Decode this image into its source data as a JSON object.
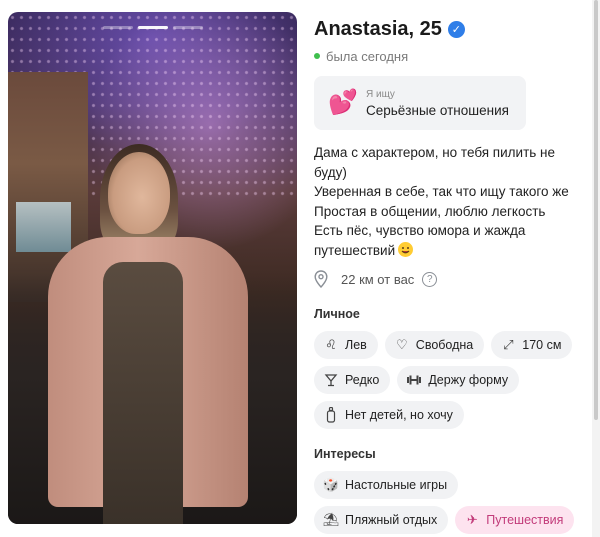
{
  "profile": {
    "name": "Anastasia, 25",
    "status": "была сегодня",
    "colors": {
      "accent": "#2f7ee8",
      "online": "#3fbf4d",
      "highlight_chip_bg": "#fde3ef",
      "highlight_chip_text": "#c23b7a"
    }
  },
  "photo": {
    "alt": "profile-photo",
    "segments": 3,
    "active_segment": 1
  },
  "seeking": {
    "label": "Я ищу",
    "value": "Серьёзные отношения",
    "icon": "hearts-icon"
  },
  "bio": {
    "line1": "Дама с характером, но тебя пилить не",
    "line2": "буду)",
    "line3": "Уверенная в себе, так что ищу такого же",
    "line4": "Простая в общении, люблю легкость",
    "line5": "Есть пёс, чувство юмора и жажда",
    "line6": "путешествий"
  },
  "distance": {
    "text": "22 км от вас",
    "icon": "location-pin-icon"
  },
  "personal": {
    "title": "Личное",
    "chips": [
      {
        "label": "Лев",
        "icon": "leo-icon"
      },
      {
        "label": "Свободна",
        "icon": "heart-icon"
      },
      {
        "label": "170 см",
        "icon": "height-icon"
      },
      {
        "label": "Редко",
        "icon": "glass-icon"
      },
      {
        "label": "Держу форму",
        "icon": "dumbbell-icon"
      },
      {
        "label": "Нет детей, но хочу",
        "icon": "baby-bottle-icon"
      }
    ]
  },
  "interests": {
    "title": "Интересы",
    "chips": [
      {
        "label": "Настольные игры",
        "icon": "dice-icon"
      },
      {
        "label": "Пляжный отдых",
        "icon": "beach-icon"
      },
      {
        "label": "Путешествия",
        "icon": "airplane-icon"
      }
    ]
  }
}
